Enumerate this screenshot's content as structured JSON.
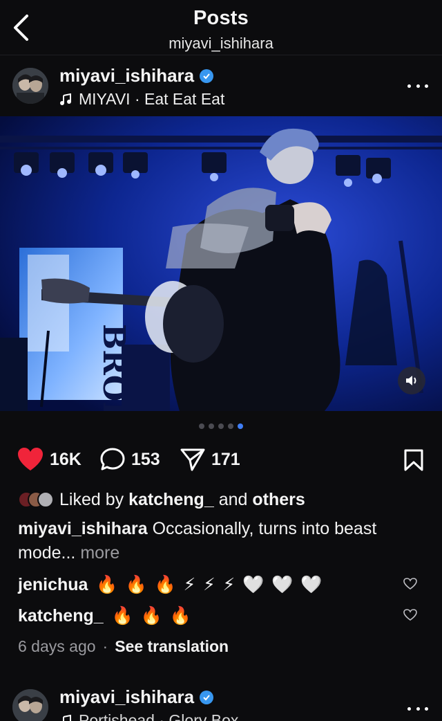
{
  "header": {
    "title": "Posts",
    "subtitle": "miyavi_ishihara"
  },
  "post": {
    "username": "miyavi_ishihara",
    "verified": true,
    "audio": "MIYAVI · Eat Eat Eat",
    "carousel": {
      "count": 5,
      "active": 5
    },
    "likes_count": "16K",
    "comments_count": "153",
    "shares_count": "171",
    "liked_by_prefix": "Liked by",
    "liked_by_user": "katcheng_",
    "liked_by_and": "and",
    "liked_by_others": "others",
    "caption_user": "miyavi_ishihara",
    "caption_text": "Occasionally, turns into beast mode...",
    "caption_more": "more",
    "comments": [
      {
        "user": "jenichua",
        "text": "🔥 🔥 🔥 ⚡ ⚡ ⚡ 🤍 🤍 🤍"
      },
      {
        "user": "katcheng_",
        "text": "🔥 🔥 🔥"
      }
    ],
    "time_ago": "6 days ago",
    "see_translation": "See translation"
  },
  "next_post": {
    "username": "miyavi_ishihara",
    "audio": "Portishead · Glory Box"
  },
  "colors": {
    "like_red": "#f0243a",
    "verified_blue": "#3897f0",
    "dot_active": "#3f7ef6"
  },
  "icons": [
    "back-chevron-icon",
    "verified-icon",
    "music-note-icon",
    "more-dots-icon",
    "heart-filled-icon",
    "comment-icon",
    "share-icon",
    "bookmark-icon",
    "speaker-icon",
    "heart-outline-icon"
  ]
}
